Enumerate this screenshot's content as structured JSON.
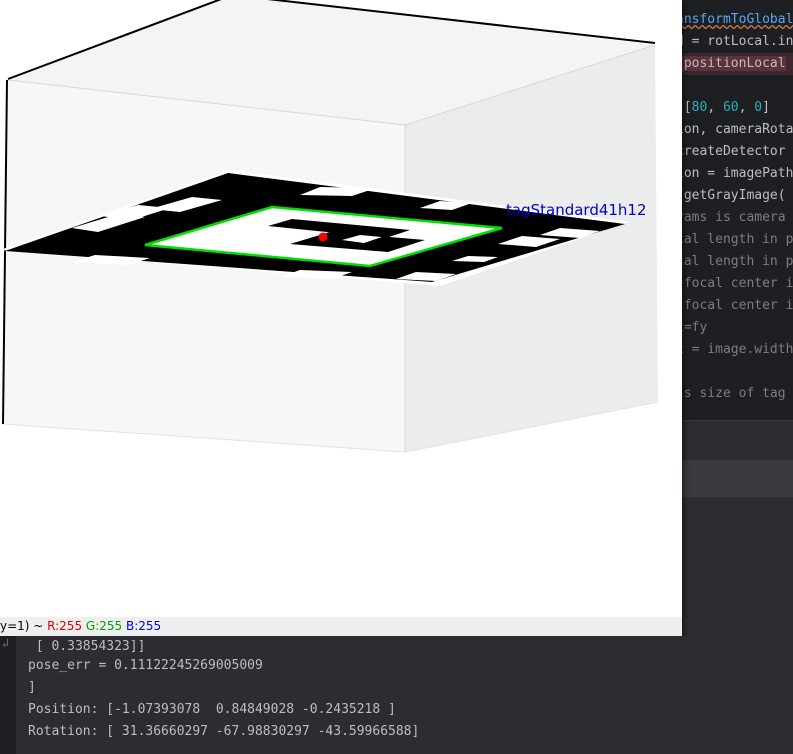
{
  "editor": {
    "lines": [
      {
        "text": "ansformToGlobal",
        "style": "fn-wavy"
      },
      {
        "text": "d = rotLocal.in",
        "style": "plain"
      },
      {
        "text": "(positionLocal",
        "style": "err"
      },
      {
        "text": "",
        "style": "plain"
      },
      {
        "pre": " [",
        "num1": "80",
        "sep1": ", ",
        "num2": "60",
        "sep2": ", ",
        "num3": "0",
        "post": "]",
        "style": "array"
      },
      {
        "text": "ion, cameraRota",
        "style": "plain"
      },
      {
        "text": "createDetector",
        "style": "plain"
      },
      {
        "text": "ion = imagePath",
        "style": "plain"
      },
      {
        "text": " getGrayImage(",
        "style": "plain"
      },
      {
        "text": "rams is camera",
        "style": "comment"
      },
      {
        "text": "cal length in p",
        "style": "comment"
      },
      {
        "text": "cal length in p",
        "style": "comment"
      },
      {
        "text": " focal center i",
        "style": "comment"
      },
      {
        "text": " focal center i",
        "style": "comment"
      },
      {
        "text": "x=fy",
        "style": "comment"
      },
      {
        "text": "x = image.width",
        "style": "comment"
      },
      {
        "text": "",
        "style": "plain"
      },
      {
        "text": "is size of tag",
        "style": "comment"
      }
    ]
  },
  "viewer": {
    "tag_label": "tagStandard41h12",
    "status": {
      "prefix": "y=1) ~ ",
      "r": "R:255",
      "g": "G:255",
      "b": "B:255"
    }
  },
  "console": {
    "gutter_icon": "wrap-icon",
    "lines": [
      " [ 0.33854323]]",
      "pose_err = 0.11122245269005009",
      "]",
      "Position: [-1.07393078  0.84849028 -0.2435218 ]",
      "Rotation: [ 31.36660297 -67.98830297 -43.59966588]"
    ]
  },
  "colors": {
    "detection_outline": "#00e000",
    "center_dot": "#ff0000",
    "label": "#0000cc"
  }
}
